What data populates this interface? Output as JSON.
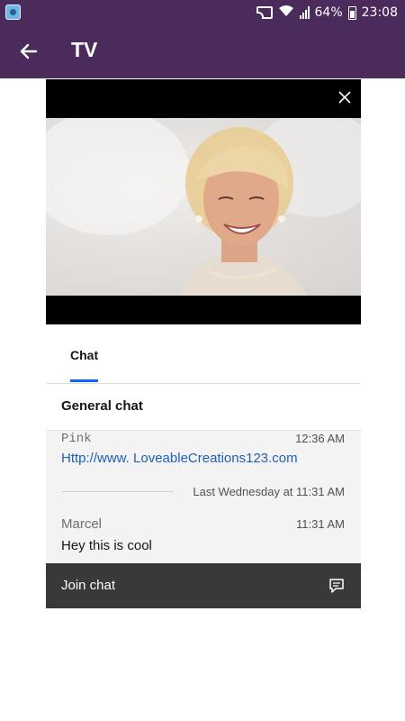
{
  "status_bar": {
    "battery": "64%",
    "time": "23:08"
  },
  "app_bar": {
    "title": "TV"
  },
  "tabs": [
    {
      "label": "Chat",
      "selected": true
    }
  ],
  "chat": {
    "header": "General chat",
    "messages": [
      {
        "author": "Pink",
        "time": "12:36 AM",
        "text_prefix": "Http://www.",
        "text_link": " LoveableCreations123.com"
      },
      {
        "author": "Marcel",
        "time": "11:31 AM",
        "text": "Hey this is cool"
      }
    ],
    "date_separator": "Last Wednesday at 11:31 AM",
    "join_label": "Join chat"
  },
  "colors": {
    "app_bar": "#4b2a5c",
    "tab_indicator": "#0f62fe",
    "link": "#1f5fb8",
    "join_bar": "#393939"
  }
}
